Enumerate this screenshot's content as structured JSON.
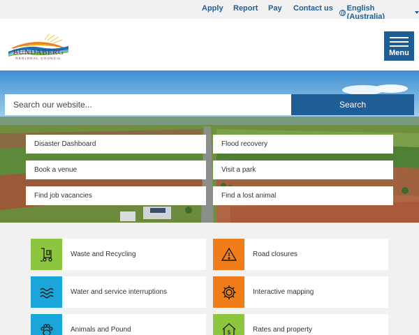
{
  "utility": {
    "apply": "Apply",
    "report": "Report",
    "pay": "Pay",
    "contact": "Contact us",
    "language": "English (Australia)"
  },
  "header": {
    "logo_name": "BUNDABERG",
    "logo_sub": "REGIONAL COUNCIL",
    "menu_label": "Menu"
  },
  "hero": {
    "search_placeholder": "Search our website...",
    "search_button": "Search",
    "quick_links": [
      "Disaster Dashboard",
      "Flood recovery",
      "Book a venue",
      "Visit a park",
      "Find job vacancies",
      "Find a lost animal"
    ]
  },
  "services": [
    {
      "label": "Waste and Recycling",
      "icon": "waste-bin-icon",
      "color": "#8cc63f"
    },
    {
      "label": "Road closures",
      "icon": "warning-icon",
      "color": "#f07d1a"
    },
    {
      "label": "Water and service interruptions",
      "icon": "water-waves-icon",
      "color": "#1aa6d9"
    },
    {
      "label": "Interactive mapping",
      "icon": "gear-icon",
      "color": "#f07d1a"
    },
    {
      "label": "Animals and Pound",
      "icon": "paw-icon",
      "color": "#1aa6d9"
    },
    {
      "label": "Rates and property",
      "icon": "house-dollar-icon",
      "color": "#8cc63f"
    }
  ],
  "colors": {
    "brand_blue": "#1f5d96",
    "green": "#8cc63f",
    "orange": "#f07d1a",
    "cyan": "#1aa6d9"
  }
}
